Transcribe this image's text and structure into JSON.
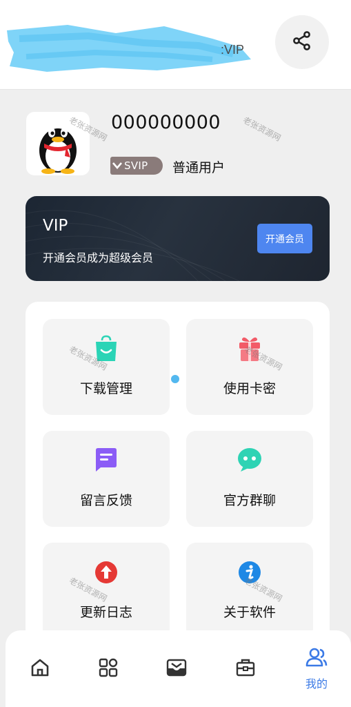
{
  "header": {
    "share_icon": "share-icon"
  },
  "profile": {
    "username": "000000000",
    "badge": "SVIP",
    "user_type": "普通用户",
    "avatar_icon": "penguin-avatar-icon"
  },
  "vip_card": {
    "title": "VIP",
    "subtitle": "开通会员成为超级会员",
    "button": "开通会员"
  },
  "menu": {
    "items": [
      {
        "label": "下载管理",
        "icon": "shopping-bag-icon",
        "color": "#2bd4b6"
      },
      {
        "label": "使用卡密",
        "icon": "gift-icon",
        "color": "#f25b68"
      },
      {
        "label": "留言反馈",
        "icon": "message-icon",
        "color": "#8b5cf6"
      },
      {
        "label": "官方群聊",
        "icon": "chat-bubble-icon",
        "color": "#2ed3b4"
      },
      {
        "label": "更新日志",
        "icon": "upgrade-icon",
        "color": "#e53935"
      },
      {
        "label": "关于软件",
        "icon": "info-icon",
        "color": "#1e88e5"
      }
    ]
  },
  "watermark": "老张资源网",
  "bottom_nav": {
    "items": [
      {
        "icon": "home-icon",
        "label": ""
      },
      {
        "icon": "apps-icon",
        "label": ""
      },
      {
        "icon": "inbox-icon",
        "label": ""
      },
      {
        "icon": "briefcase-icon",
        "label": ""
      },
      {
        "icon": "user-icon",
        "label": "我的",
        "active": true
      }
    ],
    "active_color": "#3b7ae6",
    "inactive_color": "#333333"
  }
}
